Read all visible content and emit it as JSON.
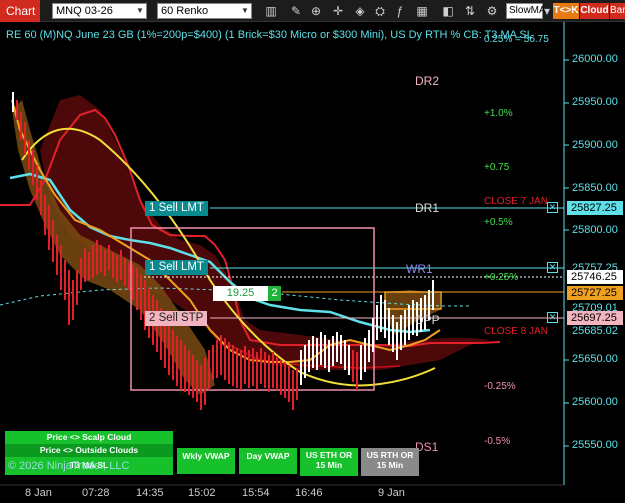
{
  "toolbar": {
    "app_tab": "Chart",
    "instrument": "MNQ 03-26",
    "interval": "60 Renko",
    "indicator": "SlowMA",
    "tk_button": "T<>K",
    "cloud_button": "Cloud",
    "bar_button": "Bar"
  },
  "chart": {
    "title": "RE 60 (M)NQ June 23 GB (1%=200p=$400) (1 Brick=$30 Micro or $300 Mini), US Dy RTH % CB: T3 MA SL",
    "pct_overlay": "0.25% = 56.75",
    "y_labels": [
      "26000.00",
      "25950.00",
      "25900.00",
      "25850.00",
      "25800.00",
      "25757.25",
      "25709.01",
      "25685.02",
      "25650.00",
      "25600.00",
      "25550.00"
    ],
    "price_tags": {
      "dr1": "25827.25",
      "last": "25746.25",
      "mid": "25727.25",
      "stop": "25697.25"
    },
    "orders": {
      "sell_lmt_1": "1 Sell LMT",
      "sell_lmt_2": "1 Sell LMT",
      "sell_stp": "2 Sell STP"
    },
    "levels": {
      "dr2": "DR2",
      "dr1": "DR1",
      "wr1": "WR1",
      "dpp": "DPP",
      "ds1": "DS1",
      "p1": "+1.0%",
      "p075": "+0.75",
      "p05": "+0.5%",
      "p025": "+0.25%",
      "m025": "-0.25%",
      "m05": "-0.5%",
      "close7": "CLOSE 7 JAN",
      "close8": "CLOSE 8 JAN"
    },
    "range_badge": {
      "value": "19.25",
      "count": "2"
    },
    "x_labels": [
      "8 Jan",
      "07:28",
      "14:35",
      "15:02",
      "15:54",
      "16:46",
      "9 Jan"
    ],
    "copyright": "© 2026 NinjaTrader, LLC"
  },
  "buttons": {
    "scalp_cloud": "Price <> Scalp Cloud",
    "outside_clouds": "Price <> Outside Clouds",
    "t3_ma": "T3 MA SL",
    "wkly_vwap": "Wkly VWAP",
    "day_vwap": "Day VWAP",
    "eth_or": "US ETH OR 15 Min",
    "rth_or": "US RTH OR 15 Min"
  },
  "colors": {
    "accent": "#5ee0e8",
    "bull_candle": "#ffffff",
    "bear_candle": "#e3202a",
    "cloud_brown": "#7a4a10",
    "cloud_red": "#5a0a0a",
    "orange_line": "#f0a020",
    "yellow_line": "#f3df3a"
  }
}
